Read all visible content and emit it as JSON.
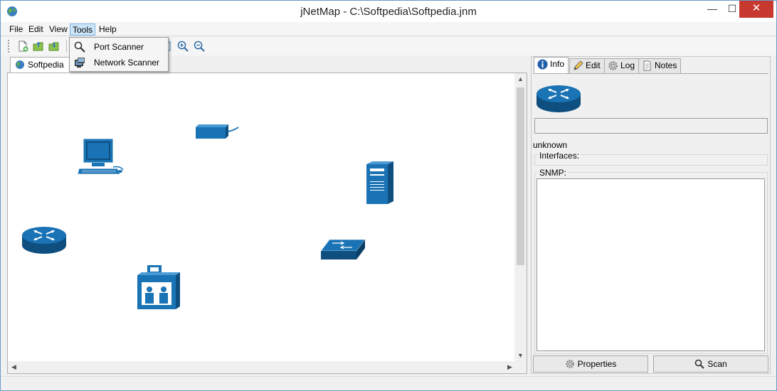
{
  "window": {
    "title": "jNetMap - C:\\Softpedia\\Softpedia.jnm",
    "minimize_glyph": "—",
    "maximize_glyph": "☐",
    "close_glyph": "✕"
  },
  "menubar": {
    "items": [
      {
        "label": "File"
      },
      {
        "label": "Edit"
      },
      {
        "label": "View"
      },
      {
        "label": "Tools"
      },
      {
        "label": "Help"
      }
    ]
  },
  "tools_menu": {
    "items": [
      {
        "label": "Port Scanner",
        "icon": "magnifier-icon"
      },
      {
        "label": "Network Scanner",
        "icon": "monitor-icon"
      }
    ]
  },
  "map_tabs": [
    {
      "label": "Softpedia",
      "icon": "globe-icon"
    }
  ],
  "devices": [
    {
      "type": "workstation",
      "label": ""
    },
    {
      "type": "modem",
      "label": ""
    },
    {
      "type": "server",
      "label": ""
    },
    {
      "type": "router",
      "label": ""
    },
    {
      "type": "switch",
      "label": ""
    },
    {
      "type": "phone",
      "label": ""
    }
  ],
  "details": {
    "tabs": [
      {
        "label": "Info",
        "icon": "info-icon"
      },
      {
        "label": "Edit",
        "icon": "pencil-icon"
      },
      {
        "label": "Log",
        "icon": "gear-icon"
      },
      {
        "label": "Notes",
        "icon": "notes-icon"
      }
    ],
    "status": "unknown",
    "interfaces_label": "Interfaces:",
    "snmp_label": "SNMP:",
    "properties_button": "Properties",
    "scan_button": "Scan"
  },
  "colors": {
    "device_blue": "#1a73b5",
    "device_dark": "#0e4f80",
    "menu_highlight": "#cce4f7",
    "close_red": "#c7392f"
  }
}
